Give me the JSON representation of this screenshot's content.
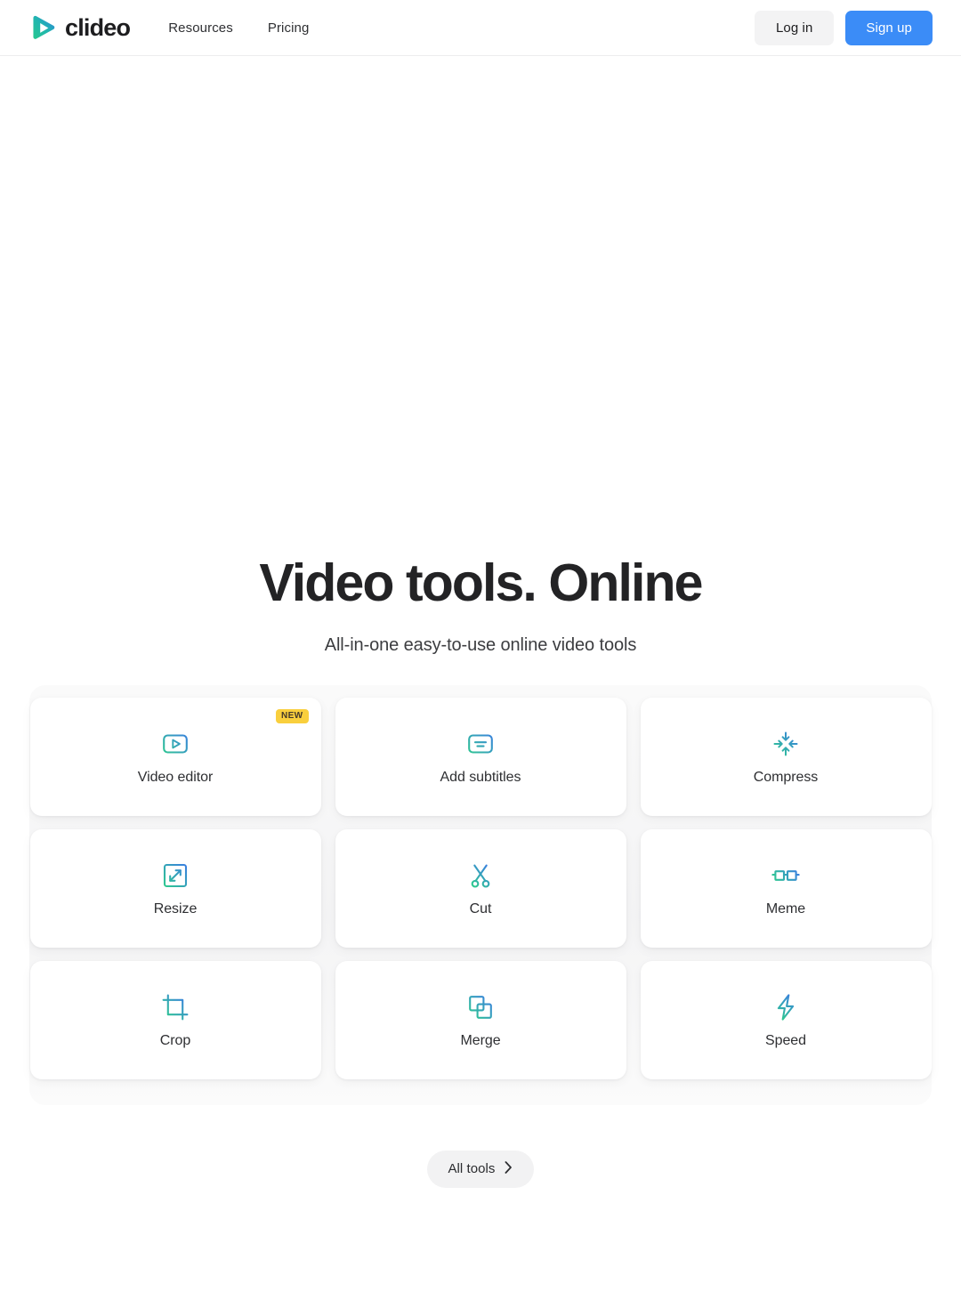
{
  "header": {
    "brand": {
      "name": "clideo",
      "logo_icon": "clideo-play-logo"
    },
    "nav": [
      {
        "label": "Resources",
        "name": "resources"
      },
      {
        "label": "Pricing",
        "name": "pricing"
      }
    ],
    "login_label": "Log in",
    "signup_label": "Sign up"
  },
  "hero": {
    "title": "Video tools. Online",
    "subtitle": "All-in-one easy-to-use online video tools"
  },
  "tools": [
    {
      "label": "Video editor",
      "icon": "video-editor-icon",
      "badge": "NEW"
    },
    {
      "label": "Add subtitles",
      "icon": "add-subtitles-icon",
      "badge": null
    },
    {
      "label": "Compress",
      "icon": "compress-icon",
      "badge": null
    },
    {
      "label": "Resize",
      "icon": "resize-icon",
      "badge": null
    },
    {
      "label": "Cut",
      "icon": "cut-scissors-icon",
      "badge": null
    },
    {
      "label": "Meme",
      "icon": "meme-glasses-icon",
      "badge": null
    },
    {
      "label": "Crop",
      "icon": "crop-icon",
      "badge": null
    },
    {
      "label": "Merge",
      "icon": "merge-icon",
      "badge": null
    },
    {
      "label": "Speed",
      "icon": "speed-bolt-icon",
      "badge": null
    }
  ],
  "footer_cta": {
    "label": "All tools",
    "icon": "chevron-right-icon"
  },
  "colors": {
    "accent_blue": "#3b8cf7",
    "gradient_start": "#2f9fe0",
    "gradient_end": "#2ec98f",
    "badge_yellow": "#f9cf3d",
    "text_dark": "#232325",
    "surface": "#f4f4f5"
  }
}
